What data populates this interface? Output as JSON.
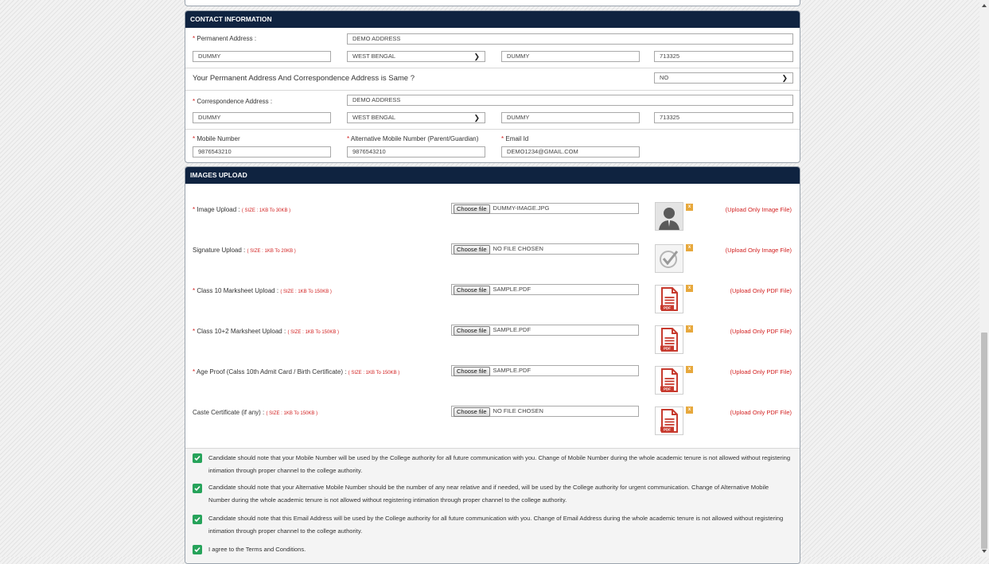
{
  "contact": {
    "title": "CONTACT INFORMATION",
    "permanent_label": "Permanent Address :",
    "permanent_address": "DEMO ADDRESS",
    "perm_city": "DUMMY",
    "perm_state": "WEST BENGAL",
    "perm_district": "DUMMY",
    "perm_pin": "713325",
    "same_question": "Your Permanent Address And Correspondence Address is Same ?",
    "same_value": "NO",
    "correspondence_label": "Correspondence Address :",
    "correspondence_address": "DEMO ADDRESS",
    "corr_city": "DUMMY",
    "corr_state": "WEST BENGAL",
    "corr_district": "DUMMY",
    "corr_pin": "713325",
    "mobile_label": "Mobile Number",
    "mobile_value": "9876543210",
    "alt_mobile_label": "Alternative Mobile Number (Parent/Guardian)",
    "alt_mobile_value": "9876543210",
    "email_label": "Email Id",
    "email_value": "DEMO1234@GMAIL.COM",
    "required_mark": "*"
  },
  "images": {
    "title": "IMAGES UPLOAD",
    "choose_label": "Choose file",
    "remove_label": "x",
    "rows": [
      {
        "label": "Image Upload :",
        "size": "( SIZE : 1KB To 30KB )",
        "file": "DUMMY-IMAGE.JPG",
        "note": "(Upload Only Image File)",
        "thumb": "person-photo-icon"
      },
      {
        "label": "Signature Upload :",
        "size": "( SIZE : 1KB To 20KB )",
        "file": "NO FILE CHOSEN",
        "note": "(Upload Only Image File)",
        "thumb": "signature-icon"
      },
      {
        "label": "Class 10 Marksheet Upload :",
        "size": "( SIZE : 1KB To 150KB )",
        "file": "SAMPLE.PDF",
        "note": "(Upload Only PDF File)",
        "thumb": "pdf-icon"
      },
      {
        "label": "Class 10+2 Marksheet Upload :",
        "size": "( SIZE : 1KB To 150KB )",
        "file": "SAMPLE.PDF",
        "note": "(Upload Only PDF File)",
        "thumb": "pdf-icon"
      },
      {
        "label": "Age Proof (Calss 10th Admit Card / Birth Certificate) :",
        "size": "( SIZE : 1KB To 150KB )",
        "file": "SAMPLE.PDF",
        "note": "(Upload Only PDF File)",
        "thumb": "pdf-icon"
      },
      {
        "label": "Caste Certificate (if any) :",
        "size": "( SIZE : 1KB To 150KB )",
        "file": "NO FILE CHOSEN",
        "note": "(Upload Only PDF File)",
        "thumb": "pdf-icon"
      }
    ]
  },
  "declarations": [
    "Candidate should note that your Mobile Number will be used by the College authority for all future communication with you. Change of Mobile Number during the whole academic tenure is not allowed without registering intimation through proper channel to the college authority.",
    "Candidate should note that your Alternative Mobile Number should be the number of any near relative and if needed, will be used by the College authority for urgent communication. Change of Alternative Mobile Number during the whole academic tenure is not allowed without registering intimation through proper channel to the college authority.",
    "Candidate should note that this Email Address will be used by the College authority for all future communication with you. Change of Email Address during the whole academic tenure is not allowed without registering intimation through proper channel to the college authority.",
    "I agree to the Terms and Conditions."
  ],
  "colors": {
    "header": "#0f2340",
    "required": "#d21f1f",
    "check": "#26a35a",
    "remove": "#e7a83c"
  }
}
